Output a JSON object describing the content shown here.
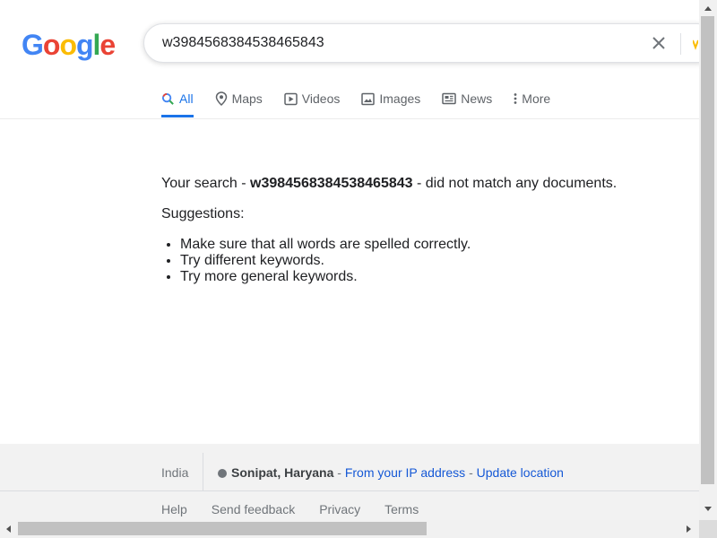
{
  "logo": {
    "text": "Google",
    "colors": [
      "#4285f4",
      "#ea4335",
      "#fbbc05",
      "#4285f4",
      "#34a853",
      "#ea4335"
    ]
  },
  "search": {
    "value": "w3984568384538465843"
  },
  "tabs": [
    {
      "label": "All",
      "icon": "search-icon",
      "active": true
    },
    {
      "label": "Maps",
      "icon": "map-pin-icon",
      "active": false
    },
    {
      "label": "Videos",
      "icon": "video-play-icon",
      "active": false
    },
    {
      "label": "Images",
      "icon": "image-icon",
      "active": false
    },
    {
      "label": "News",
      "icon": "news-icon",
      "active": false
    },
    {
      "label": "More",
      "icon": "more-vert-icon",
      "active": false
    }
  ],
  "results": {
    "no_match_prefix": "Your search - ",
    "no_match_query": "w3984568384538465843",
    "no_match_suffix": " - did not match any documents.",
    "suggestions_heading": "Suggestions:",
    "suggestions": [
      "Make sure that all words are spelled correctly.",
      "Try different keywords.",
      "Try more general keywords."
    ]
  },
  "footer": {
    "country": "India",
    "location_place": "Sonipat, Haryana",
    "location_sep1": " - ",
    "location_source": "From your IP address",
    "location_sep2": " - ",
    "update_location": "Update location",
    "links": [
      "Help",
      "Send feedback",
      "Privacy",
      "Terms"
    ]
  },
  "colors": {
    "accent": "#1a73e8",
    "link": "#1558d6",
    "muted": "#70757a",
    "footer_bg": "#f2f2f2"
  }
}
